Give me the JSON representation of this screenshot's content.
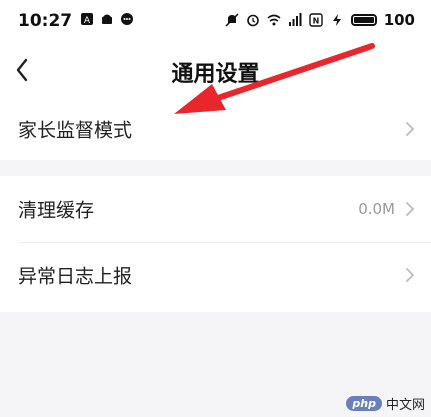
{
  "status_bar": {
    "time": "10:27",
    "left_icons": [
      "notification-a-icon",
      "android-icon",
      "message-icon"
    ],
    "right_icons": [
      "mute-icon",
      "alarm-icon",
      "wifi-icon",
      "signal-icon",
      "nfc-icon",
      "charging-icon"
    ],
    "battery": "100"
  },
  "header": {
    "title": "通用设置",
    "back_icon": "chevron-left-icon"
  },
  "settings": {
    "group1": [
      {
        "label": "家长监督模式",
        "value": ""
      }
    ],
    "group2": [
      {
        "label": "清理缓存",
        "value": "0.0M"
      },
      {
        "label": "异常日志上报",
        "value": ""
      }
    ]
  },
  "annotation": {
    "arrow_color": "#e8262c"
  },
  "watermark": {
    "badge": "php",
    "text": "中文网"
  },
  "colors": {
    "background": "#f5f5f7",
    "card": "#ffffff",
    "text": "#222222",
    "muted": "#999999"
  }
}
